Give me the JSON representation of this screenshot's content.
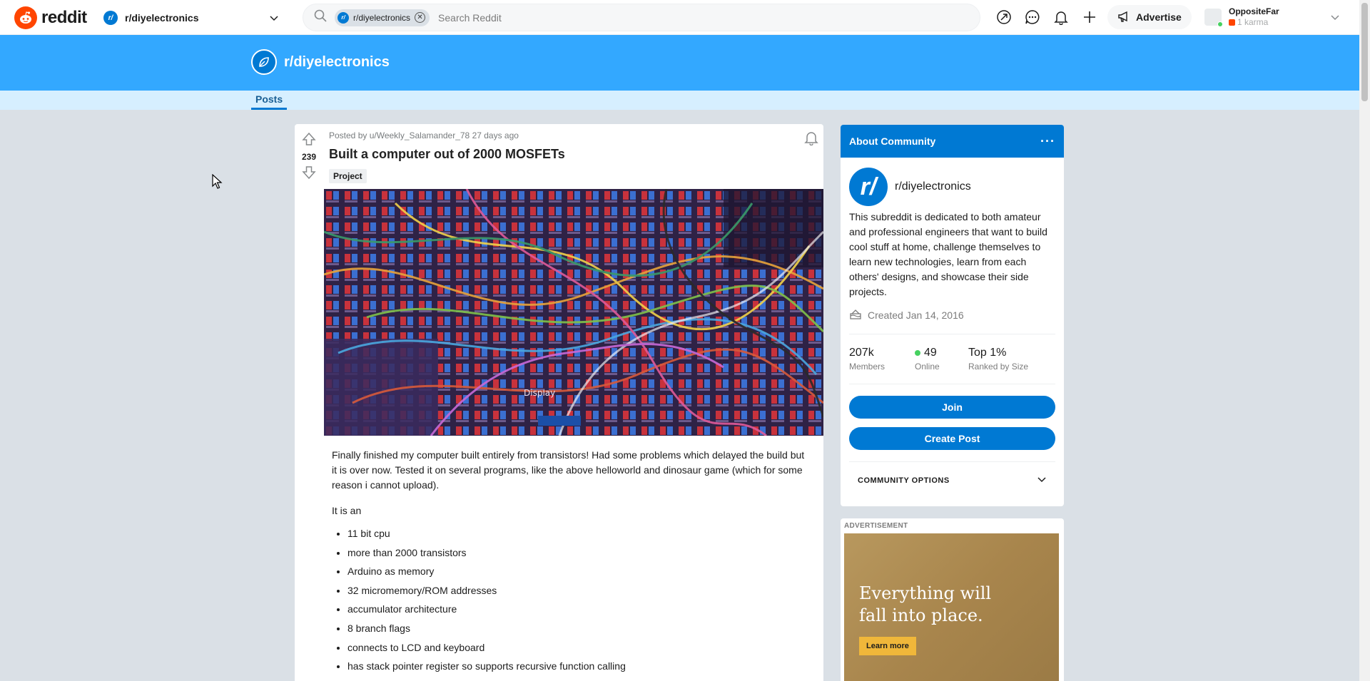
{
  "header": {
    "logo_text": "reddit",
    "community_icon": "r/",
    "community_name": "r/diyelectronics",
    "search_chip": "r/diyelectronics",
    "search_placeholder": "Search Reddit",
    "advertise_label": "Advertise",
    "username": "OppositeFar",
    "karma": "1 karma",
    "icons": [
      "popular-icon",
      "chat-icon",
      "notifications-icon",
      "create-post-icon",
      "megaphone-icon"
    ]
  },
  "banner": {
    "title": "r/diyelectronics",
    "tab_posts": "Posts"
  },
  "post": {
    "score": "239",
    "meta": "Posted by u/Weekly_Salamander_78 27 days ago",
    "title": "Built a computer out of 2000 MOSFETs",
    "flair": "Project",
    "image_label": "Display",
    "paragraph1": "Finally finished my computer built entirely from transistors! Had some problems which delayed the build but it is over now. Tested it on several programs, like the above helloworld and dinosaur game (which for some reason i cannot upload).",
    "paragraph2": "It is an",
    "bullets": [
      "11 bit cpu",
      "more than 2000 transistors",
      "Arduino as memory",
      "32 micromemory/ROM addresses",
      "accumulator architecture",
      "8 branch flags",
      "connects to LCD and keyboard",
      "has stack pointer register so supports recursive function calling"
    ]
  },
  "about": {
    "heading": "About Community",
    "more": "···",
    "icon_text": "r/",
    "name": "r/diyelectronics",
    "description": "This subreddit is dedicated to both amateur and professional engineers that want to build cool stuff at home, challenge themselves to learn new technologies, learn from each others' designs, and showcase their side projects.",
    "created": "Created Jan 14, 2016",
    "members_value": "207k",
    "members_label": "Members",
    "online_value": "49",
    "online_label": "Online",
    "rank_value": "Top 1%",
    "rank_label": "Ranked by Size",
    "join_label": "Join",
    "create_post_label": "Create Post",
    "options_label": "COMMUNITY OPTIONS"
  },
  "ad": {
    "label": "ADVERTISEMENT",
    "headline_line1": "Everything will",
    "headline_line2": "fall into place.",
    "cta": "Learn more"
  }
}
